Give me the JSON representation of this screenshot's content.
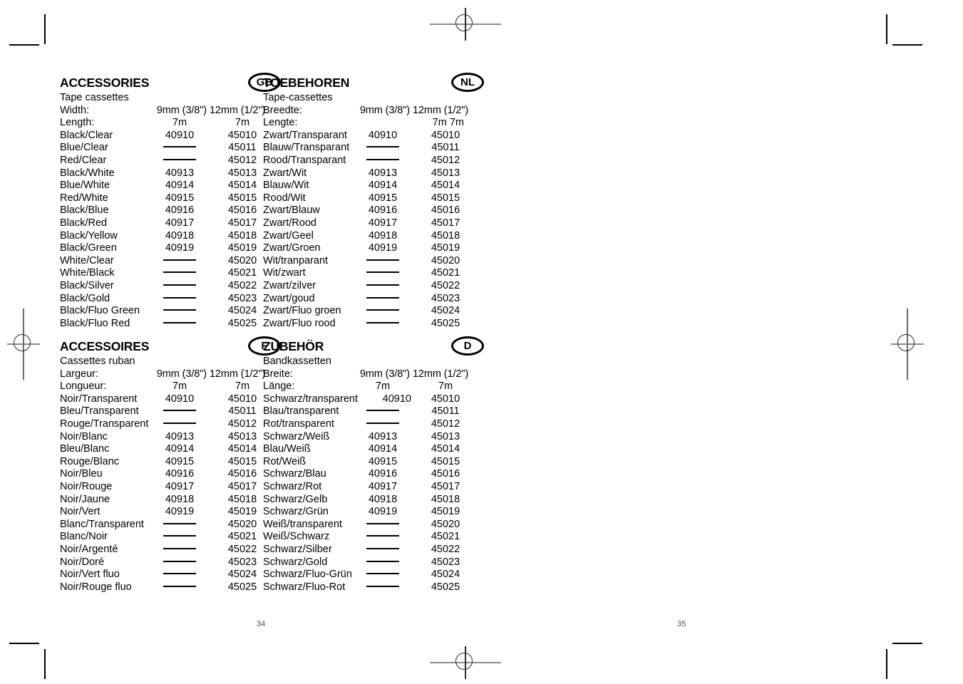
{
  "document": {
    "page_numbers": {
      "left": "34",
      "right": "35"
    }
  },
  "blocks": [
    {
      "id": "gb",
      "title": "ACCESSORIES",
      "badge": "GB",
      "subtitle": "Tape cassettes",
      "width_label": "Width:",
      "width_values": "9mm (3/8\") 12mm (1/2\")",
      "length_label": "Length:",
      "length_v1": "7m",
      "length_v2": "7m",
      "length_joined": false,
      "first_row_overflow": false,
      "rows": [
        {
          "label": "Black/Clear",
          "v1": "40910",
          "v2": "45010"
        },
        {
          "label": "Blue/Clear",
          "v1": "—",
          "v2": "45011"
        },
        {
          "label": "Red/Clear",
          "v1": "—",
          "v2": "45012"
        },
        {
          "label": "Black/White",
          "v1": "40913",
          "v2": "45013"
        },
        {
          "label": "Blue/White",
          "v1": "40914",
          "v2": "45014"
        },
        {
          "label": "Red/White",
          "v1": "40915",
          "v2": "45015"
        },
        {
          "label": "Black/Blue",
          "v1": "40916",
          "v2": "45016"
        },
        {
          "label": "Black/Red",
          "v1": "40917",
          "v2": "45017"
        },
        {
          "label": "Black/Yellow",
          "v1": "40918",
          "v2": "45018"
        },
        {
          "label": "Black/Green",
          "v1": "40919",
          "v2": "45019"
        },
        {
          "label": "White/Clear",
          "v1": "—",
          "v2": "45020"
        },
        {
          "label": "White/Black",
          "v1": "—",
          "v2": "45021"
        },
        {
          "label": "Black/Silver",
          "v1": "—",
          "v2": "45022"
        },
        {
          "label": "Black/Gold",
          "v1": "—",
          "v2": "45023"
        },
        {
          "label": "Black/Fluo Green",
          "v1": "—",
          "v2": "45024"
        },
        {
          "label": "Black/Fluo Red",
          "v1": "—",
          "v2": "45025"
        }
      ]
    },
    {
      "id": "nl",
      "title": "TOEBEHOREN",
      "badge": "NL",
      "subtitle": "Tape-cassettes",
      "width_label": "Breedte:",
      "width_values": "9mm (3/8\") 12mm (1/2\")",
      "length_label": "Lengte:",
      "length_v1": "7m",
      "length_v2": "7m",
      "length_joined": true,
      "length_pair": "7m 7m",
      "first_row_overflow": false,
      "rows": [
        {
          "label": "Zwart/Transparant",
          "v1": "40910",
          "v2": "45010"
        },
        {
          "label": "Blauw/Transparant",
          "v1": "—",
          "v2": "45011"
        },
        {
          "label": "Rood/Transparant",
          "v1": "—",
          "v2": "45012"
        },
        {
          "label": "Zwart/Wit",
          "v1": "40913",
          "v2": "45013"
        },
        {
          "label": "Blauw/Wit",
          "v1": "40914",
          "v2": "45014"
        },
        {
          "label": "Rood/Wit",
          "v1": "40915",
          "v2": "45015"
        },
        {
          "label": "Zwart/Blauw",
          "v1": "40916",
          "v2": "45016"
        },
        {
          "label": "Zwart/Rood",
          "v1": "40917",
          "v2": "45017"
        },
        {
          "label": "Zwart/Geel",
          "v1": "40918",
          "v2": "45018"
        },
        {
          "label": "Zwart/Groen",
          "v1": "40919",
          "v2": "45019"
        },
        {
          "label": "Wit/tranparant",
          "v1": "—",
          "v2": "45020"
        },
        {
          "label": "Wit/zwart",
          "v1": "—",
          "v2": "45021"
        },
        {
          "label": "Zwart/zilver",
          "v1": "—",
          "v2": "45022"
        },
        {
          "label": "Zwart/goud",
          "v1": "—",
          "v2": "45023"
        },
        {
          "label": "Zwart/Fluo groen",
          "v1": "—",
          "v2": "45024"
        },
        {
          "label": "Zwart/Fluo rood",
          "v1": "—",
          "v2": "45025"
        }
      ]
    },
    {
      "id": "fr",
      "title": "ACCESSOIRES",
      "badge": "F",
      "subtitle": "Cassettes ruban",
      "width_label": "Largeur:",
      "width_values": "9mm (3/8\") 12mm (1/2\")",
      "length_label": "Longueur:",
      "length_v1": "7m",
      "length_v2": "7m",
      "length_joined": false,
      "first_row_overflow": false,
      "rows": [
        {
          "label": "Noir/Transparent",
          "v1": "40910",
          "v2": "45010"
        },
        {
          "label": "Bleu/Transparent",
          "v1": "—",
          "v2": "45011"
        },
        {
          "label": "Rouge/Transparent",
          "v1": "—",
          "v2": "45012"
        },
        {
          "label": "Noir/Blanc",
          "v1": "40913",
          "v2": "45013"
        },
        {
          "label": "Bleu/Blanc",
          "v1": "40914",
          "v2": "45014"
        },
        {
          "label": "Rouge/Blanc",
          "v1": "40915",
          "v2": "45015"
        },
        {
          "label": "Noir/Bleu",
          "v1": "40916",
          "v2": "45016"
        },
        {
          "label": "Noir/Rouge",
          "v1": "40917",
          "v2": "45017"
        },
        {
          "label": "Noir/Jaune",
          "v1": "40918",
          "v2": "45018"
        },
        {
          "label": "Noir/Vert",
          "v1": "40919",
          "v2": "45019"
        },
        {
          "label": "Blanc/Transparent",
          "v1": "—",
          "v2": "45020"
        },
        {
          "label": "Blanc/Noir",
          "v1": "—",
          "v2": "45021"
        },
        {
          "label": "Noir/Argenté",
          "v1": "—",
          "v2": "45022"
        },
        {
          "label": "Noir/Doré",
          "v1": "—",
          "v2": "45023"
        },
        {
          "label": "Noir/Vert fluo",
          "v1": "—",
          "v2": "45024"
        },
        {
          "label": "Noir/Rouge fluo",
          "v1": "—",
          "v2": "45025"
        }
      ]
    },
    {
      "id": "de",
      "title": "ZUBEHÖR",
      "badge": "D",
      "subtitle": "Bandkassetten",
      "width_label": "Breite:",
      "width_values": "9mm (3/8\") 12mm (1/2\")",
      "length_label": "Länge:",
      "length_v1": "7m",
      "length_v2": "7m",
      "length_joined": false,
      "first_row_overflow": true,
      "rows": [
        {
          "label": "Schwarz/transparent",
          "v1": "40910",
          "v2": "45010"
        },
        {
          "label": "Blau/transparent",
          "v1": "—",
          "v2": "45011"
        },
        {
          "label": "Rot/transparent",
          "v1": "—",
          "v2": "45012"
        },
        {
          "label": "Schwarz/Weiß",
          "v1": "40913",
          "v2": "45013"
        },
        {
          "label": "Blau/Weiß",
          "v1": "40914",
          "v2": "45014"
        },
        {
          "label": "Rot/Weiß",
          "v1": "40915",
          "v2": "45015"
        },
        {
          "label": "Schwarz/Blau",
          "v1": "40916",
          "v2": "45016"
        },
        {
          "label": "Schwarz/Rot",
          "v1": "40917",
          "v2": "45017"
        },
        {
          "label": "Schwarz/Gelb",
          "v1": "40918",
          "v2": "45018"
        },
        {
          "label": "Schwarz/Grün",
          "v1": "40919",
          "v2": "45019"
        },
        {
          "label": "Weiß/transparent",
          "v1": "—",
          "v2": "45020"
        },
        {
          "label": "Weiß/Schwarz",
          "v1": "—",
          "v2": "45021"
        },
        {
          "label": "Schwarz/Silber",
          "v1": "—",
          "v2": "45022"
        },
        {
          "label": "Schwarz/Gold",
          "v1": "—",
          "v2": "45023"
        },
        {
          "label": "Schwarz/Fluo-Grün",
          "v1": "—",
          "v2": "45024"
        },
        {
          "label": "Schwarz/Fluo-Rot",
          "v1": "—",
          "v2": "45025"
        }
      ]
    }
  ]
}
